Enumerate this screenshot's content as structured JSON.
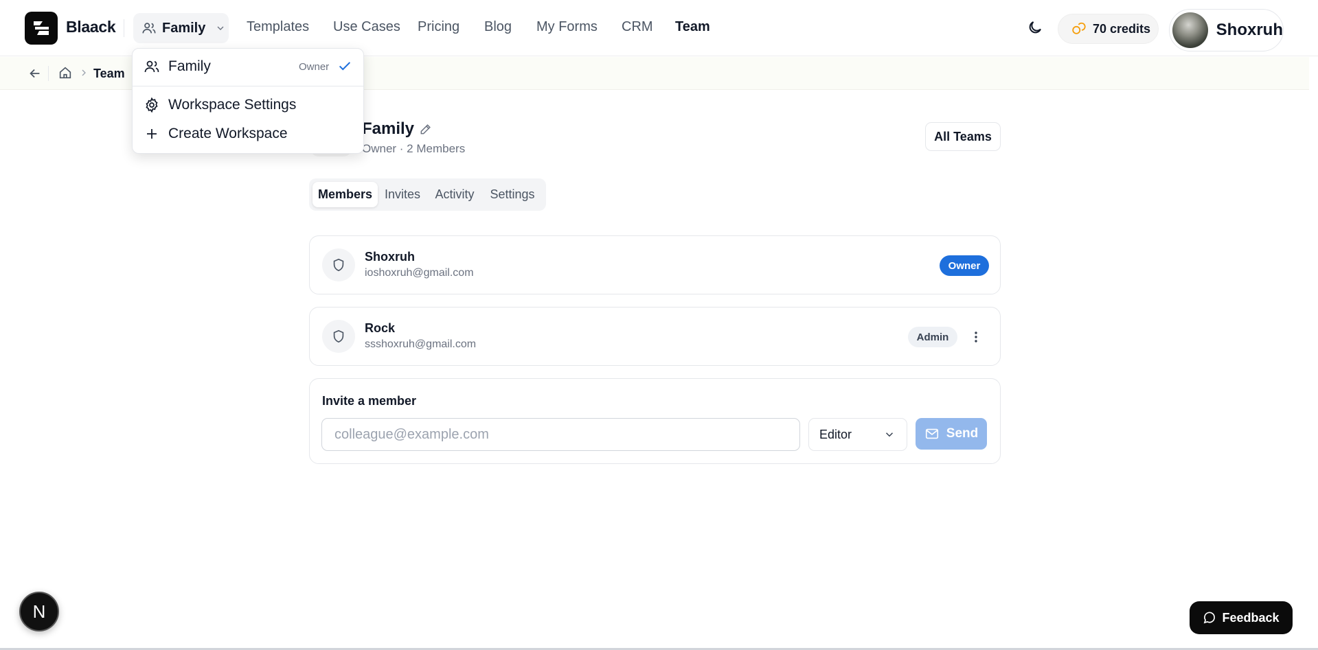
{
  "header": {
    "app_name": "Blaack",
    "workspace_label": "Family",
    "nav": [
      "Templates",
      "Use Cases",
      "Pricing",
      "Blog",
      "My Forms",
      "CRM",
      "Team"
    ],
    "credits_label": "70 credits",
    "profile_name": "Shoxruh"
  },
  "breadcrumb": {
    "current": "Team"
  },
  "workspace_menu": {
    "current_workspace": "Family",
    "current_role": "Owner",
    "settings_label": "Workspace Settings",
    "create_label": "Create Workspace"
  },
  "team": {
    "name": "Family",
    "meta": "Owner · 2 Members",
    "all_teams_label": "All Teams"
  },
  "tabs": [
    "Members",
    "Invites",
    "Activity",
    "Settings"
  ],
  "members": [
    {
      "name": "Shoxruh",
      "email": "ioshoxruh@gmail.com",
      "role": "Owner"
    },
    {
      "name": "Rock",
      "email": "ssshoxruh@gmail.com",
      "role": "Admin"
    }
  ],
  "invite": {
    "title": "Invite a member",
    "placeholder": "colleague@example.com",
    "role_value": "Editor",
    "send_label": "Send"
  },
  "floating": {
    "next_label": "N",
    "feedback_label": "Feedback"
  },
  "colors": {
    "owner_badge": "#1e6fdc",
    "send_button": "#93b8ec",
    "credits_icon": "#f59e0b"
  }
}
